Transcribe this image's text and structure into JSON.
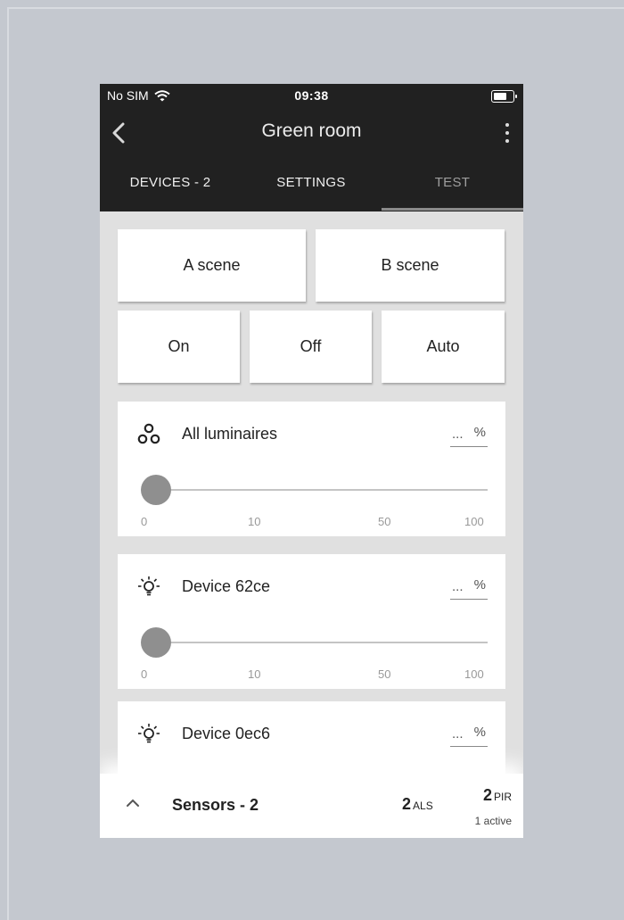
{
  "status_bar": {
    "carrier": "No SIM",
    "time": "09:38"
  },
  "header": {
    "title": "Green room"
  },
  "tabs": [
    {
      "label": "DEVICES - 2",
      "active": false
    },
    {
      "label": "SETTINGS",
      "active": false
    },
    {
      "label": "TEST",
      "active": true
    }
  ],
  "scenes": {
    "a": "A scene",
    "b": "B scene"
  },
  "modes": {
    "on": "On",
    "off": "Off",
    "auto": "Auto"
  },
  "groups": [
    {
      "name": "All luminaires",
      "value": "...",
      "unit": "%",
      "level_percent": 0,
      "ticks": [
        "0",
        "10",
        "50",
        "100"
      ],
      "icon": "luminaires-group-icon"
    },
    {
      "name": "Device 62ce",
      "value": "...",
      "unit": "%",
      "level_percent": 0,
      "ticks": [
        "0",
        "10",
        "50",
        "100"
      ],
      "icon": "bulb-icon"
    },
    {
      "name": "Device 0ec6",
      "value": "...",
      "unit": "%",
      "icon": "bulb-icon"
    }
  ],
  "sensors": {
    "label": "Sensors - 2",
    "als_count": "2",
    "als_unit": "ALS",
    "pir_count": "2",
    "pir_unit": "PIR",
    "pir_active": "1 active"
  },
  "colors": {
    "background": "#c4c8cf",
    "topbar": "#212121",
    "content": "#e0e0e0",
    "slider_thumb": "#8f8f8f"
  }
}
